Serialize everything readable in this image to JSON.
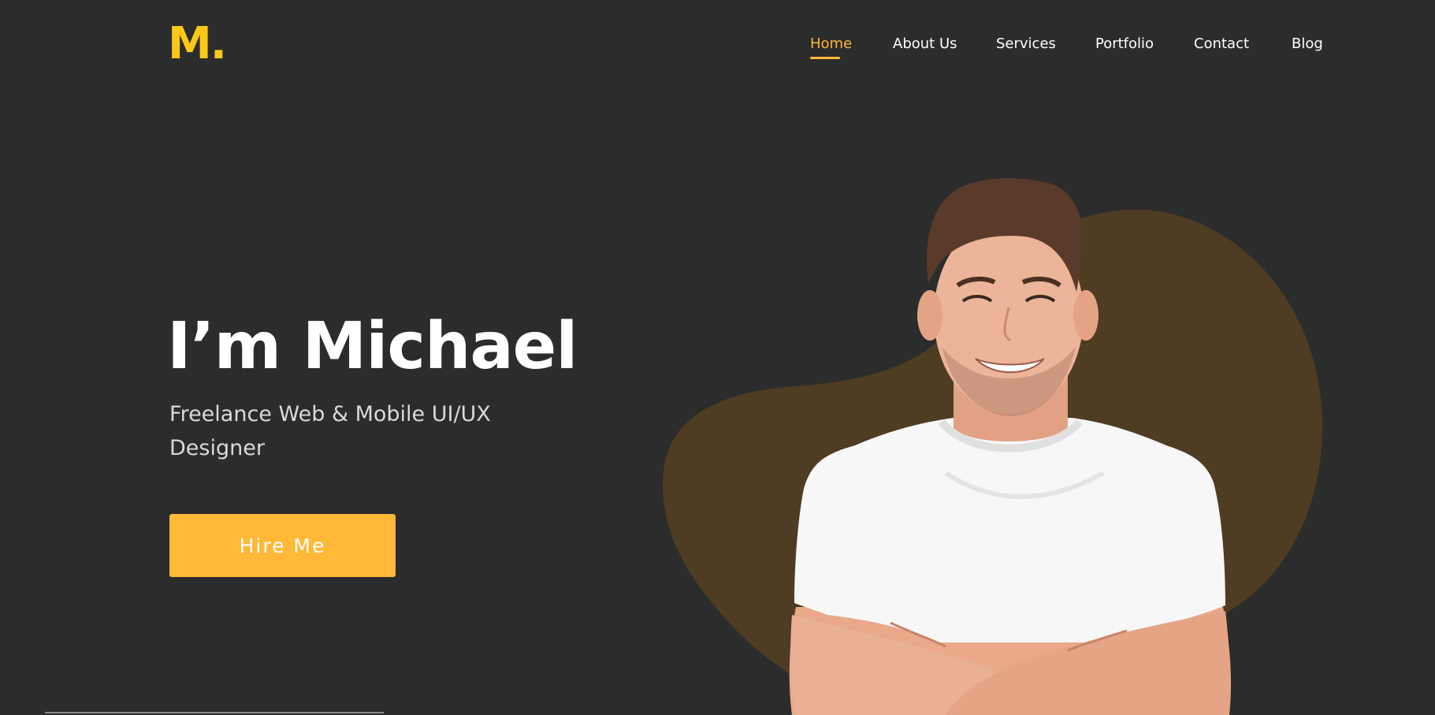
{
  "logo": {
    "text": "M."
  },
  "nav": {
    "items": [
      {
        "label": "Home",
        "active": true
      },
      {
        "label": "About Us",
        "active": false
      },
      {
        "label": "Services",
        "active": false
      },
      {
        "label": "Portfolio",
        "active": false
      },
      {
        "label": "Contact",
        "active": false
      },
      {
        "label": "Blog",
        "active": false
      }
    ]
  },
  "hero": {
    "title": "I’m Michael",
    "subtitle": "Freelance Web & Mobile UI/UX Designer",
    "cta_label": "Hire Me"
  },
  "colors": {
    "background": "#2b2c2c",
    "accent": "#ffb838",
    "logo": "#fbc817",
    "blob": "#4e3c23"
  },
  "images": {
    "portrait": "smiling-man-white-tshirt-arms-crossed"
  }
}
